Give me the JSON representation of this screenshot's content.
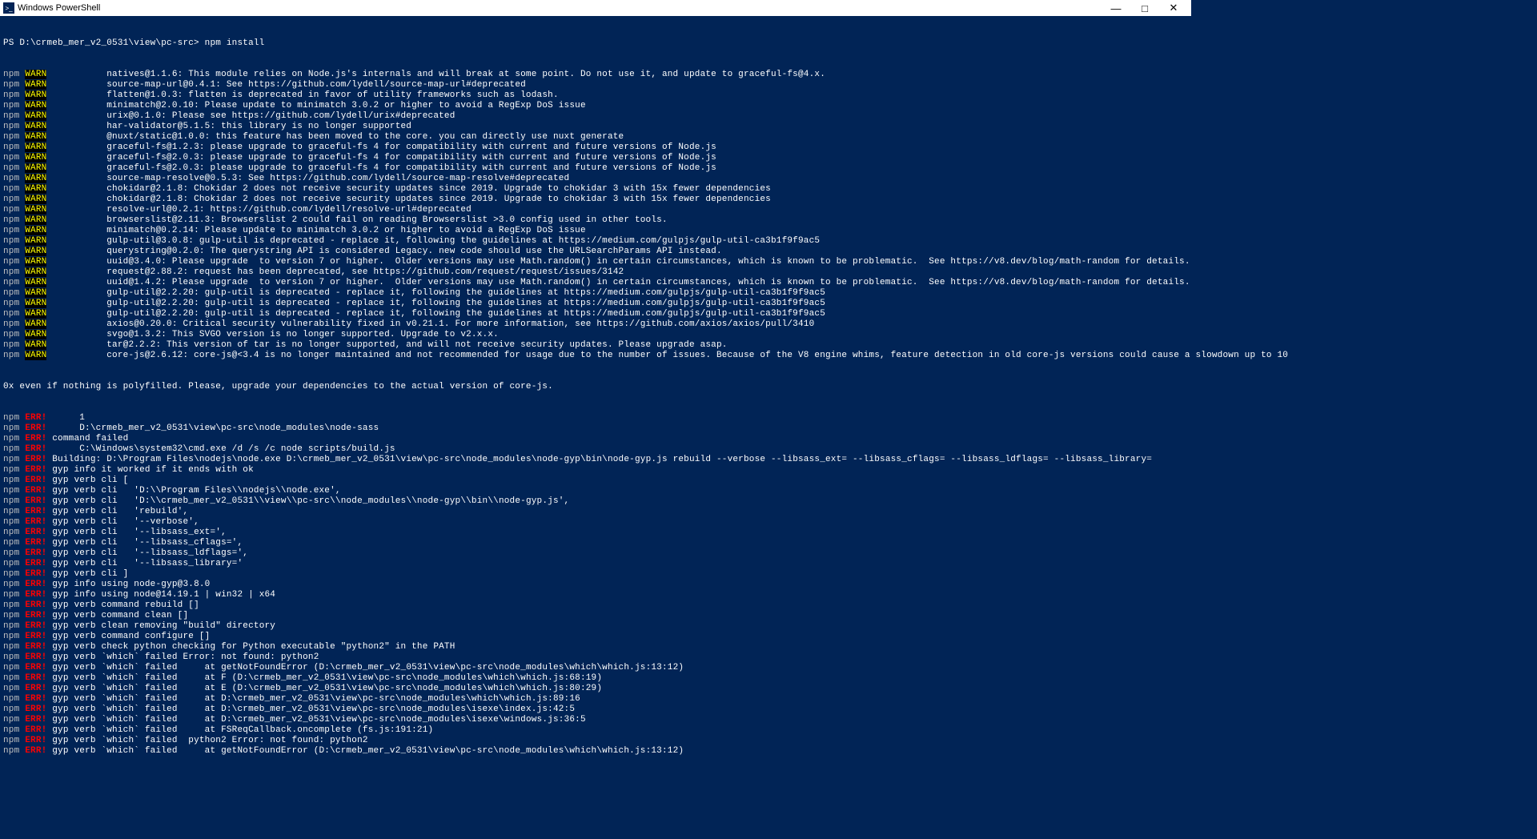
{
  "window": {
    "title": "Windows PowerShell",
    "icon_label": ">_"
  },
  "prompt": {
    "prefix": "PS ",
    "path": "D:\\crmeb_mer_v2_0531\\view\\pc-src>",
    "command": "npm install"
  },
  "tags": {
    "npm": "npm",
    "warn": "WARN",
    "err": "ERR!"
  },
  "warn_lines": [
    "natives@1.1.6: This module relies on Node.js's internals and will break at some point. Do not use it, and update to graceful-fs@4.x.",
    "source-map-url@0.4.1: See https://github.com/lydell/source-map-url#deprecated",
    "flatten@1.0.3: flatten is deprecated in favor of utility frameworks such as lodash.",
    "minimatch@2.0.10: Please update to minimatch 3.0.2 or higher to avoid a RegExp DoS issue",
    "urix@0.1.0: Please see https://github.com/lydell/urix#deprecated",
    "har-validator@5.1.5: this library is no longer supported",
    "@nuxt/static@1.0.0: this feature has been moved to the core. you can directly use nuxt generate",
    "graceful-fs@1.2.3: please upgrade to graceful-fs 4 for compatibility with current and future versions of Node.js",
    "graceful-fs@2.0.3: please upgrade to graceful-fs 4 for compatibility with current and future versions of Node.js",
    "graceful-fs@2.0.3: please upgrade to graceful-fs 4 for compatibility with current and future versions of Node.js",
    "source-map-resolve@0.5.3: See https://github.com/lydell/source-map-resolve#deprecated",
    "chokidar@2.1.8: Chokidar 2 does not receive security updates since 2019. Upgrade to chokidar 3 with 15x fewer dependencies",
    "chokidar@2.1.8: Chokidar 2 does not receive security updates since 2019. Upgrade to chokidar 3 with 15x fewer dependencies",
    "resolve-url@0.2.1: https://github.com/lydell/resolve-url#deprecated",
    "browserslist@2.11.3: Browserslist 2 could fail on reading Browserslist >3.0 config used in other tools.",
    "minimatch@0.2.14: Please update to minimatch 3.0.2 or higher to avoid a RegExp DoS issue",
    "gulp-util@3.0.8: gulp-util is deprecated - replace it, following the guidelines at https://medium.com/gulpjs/gulp-util-ca3b1f9f9ac5",
    "querystring@0.2.0: The querystring API is considered Legacy. new code should use the URLSearchParams API instead.",
    "uuid@3.4.0: Please upgrade  to version 7 or higher.  Older versions may use Math.random() in certain circumstances, which is known to be problematic.  See https://v8.dev/blog/math-random for details.",
    "request@2.88.2: request has been deprecated, see https://github.com/request/request/issues/3142",
    "uuid@1.4.2: Please upgrade  to version 7 or higher.  Older versions may use Math.random() in certain circumstances, which is known to be problematic.  See https://v8.dev/blog/math-random for details.",
    "gulp-util@2.2.20: gulp-util is deprecated - replace it, following the guidelines at https://medium.com/gulpjs/gulp-util-ca3b1f9f9ac5",
    "gulp-util@2.2.20: gulp-util is deprecated - replace it, following the guidelines at https://medium.com/gulpjs/gulp-util-ca3b1f9f9ac5",
    "gulp-util@2.2.20: gulp-util is deprecated - replace it, following the guidelines at https://medium.com/gulpjs/gulp-util-ca3b1f9f9ac5",
    "axios@0.20.0: Critical security vulnerability fixed in v0.21.1. For more information, see https://github.com/axios/axios/pull/3410",
    "svgo@1.3.2: This SVGO version is no longer supported. Upgrade to v2.x.x.",
    "tar@2.2.2: This version of tar is no longer supported, and will not receive security updates. Please upgrade asap.",
    "core-js@2.6.12: core-js@<3.4 is no longer maintained and not recommended for usage due to the number of issues. Because of the V8 engine whims, feature detection in old core-js versions could cause a slowdown up to 10"
  ],
  "warn_tail": "0x even if nothing is polyfilled. Please, upgrade your dependencies to the actual version of core-js.",
  "err_lines": [
    "     1",
    "     D:\\crmeb_mer_v2_0531\\view\\pc-src\\node_modules\\node-sass",
    "command failed",
    "     C:\\Windows\\system32\\cmd.exe /d /s /c node scripts/build.js",
    "Building: D:\\Program Files\\nodejs\\node.exe D:\\crmeb_mer_v2_0531\\view\\pc-src\\node_modules\\node-gyp\\bin\\node-gyp.js rebuild --verbose --libsass_ext= --libsass_cflags= --libsass_ldflags= --libsass_library=",
    "gyp info it worked if it ends with ok",
    "gyp verb cli [",
    "gyp verb cli   'D:\\\\Program Files\\\\nodejs\\\\node.exe',",
    "gyp verb cli   'D:\\\\crmeb_mer_v2_0531\\\\view\\\\pc-src\\\\node_modules\\\\node-gyp\\\\bin\\\\node-gyp.js',",
    "gyp verb cli   'rebuild',",
    "gyp verb cli   '--verbose',",
    "gyp verb cli   '--libsass_ext=',",
    "gyp verb cli   '--libsass_cflags=',",
    "gyp verb cli   '--libsass_ldflags=',",
    "gyp verb cli   '--libsass_library='",
    "gyp verb cli ]",
    "gyp info using node-gyp@3.8.0",
    "gyp info using node@14.19.1 | win32 | x64",
    "gyp verb command rebuild []",
    "gyp verb command clean []",
    "gyp verb clean removing \"build\" directory",
    "gyp verb command configure []",
    "gyp verb check python checking for Python executable \"python2\" in the PATH",
    "gyp verb `which` failed Error: not found: python2",
    "gyp verb `which` failed     at getNotFoundError (D:\\crmeb_mer_v2_0531\\view\\pc-src\\node_modules\\which\\which.js:13:12)",
    "gyp verb `which` failed     at F (D:\\crmeb_mer_v2_0531\\view\\pc-src\\node_modules\\which\\which.js:68:19)",
    "gyp verb `which` failed     at E (D:\\crmeb_mer_v2_0531\\view\\pc-src\\node_modules\\which\\which.js:80:29)",
    "gyp verb `which` failed     at D:\\crmeb_mer_v2_0531\\view\\pc-src\\node_modules\\which\\which.js:89:16",
    "gyp verb `which` failed     at D:\\crmeb_mer_v2_0531\\view\\pc-src\\node_modules\\isexe\\index.js:42:5",
    "gyp verb `which` failed     at D:\\crmeb_mer_v2_0531\\view\\pc-src\\node_modules\\isexe\\windows.js:36:5",
    "gyp verb `which` failed     at FSReqCallback.oncomplete (fs.js:191:21)",
    "gyp verb `which` failed  python2 Error: not found: python2",
    "gyp verb `which` failed     at getNotFoundError (D:\\crmeb_mer_v2_0531\\view\\pc-src\\node_modules\\which\\which.js:13:12)"
  ]
}
